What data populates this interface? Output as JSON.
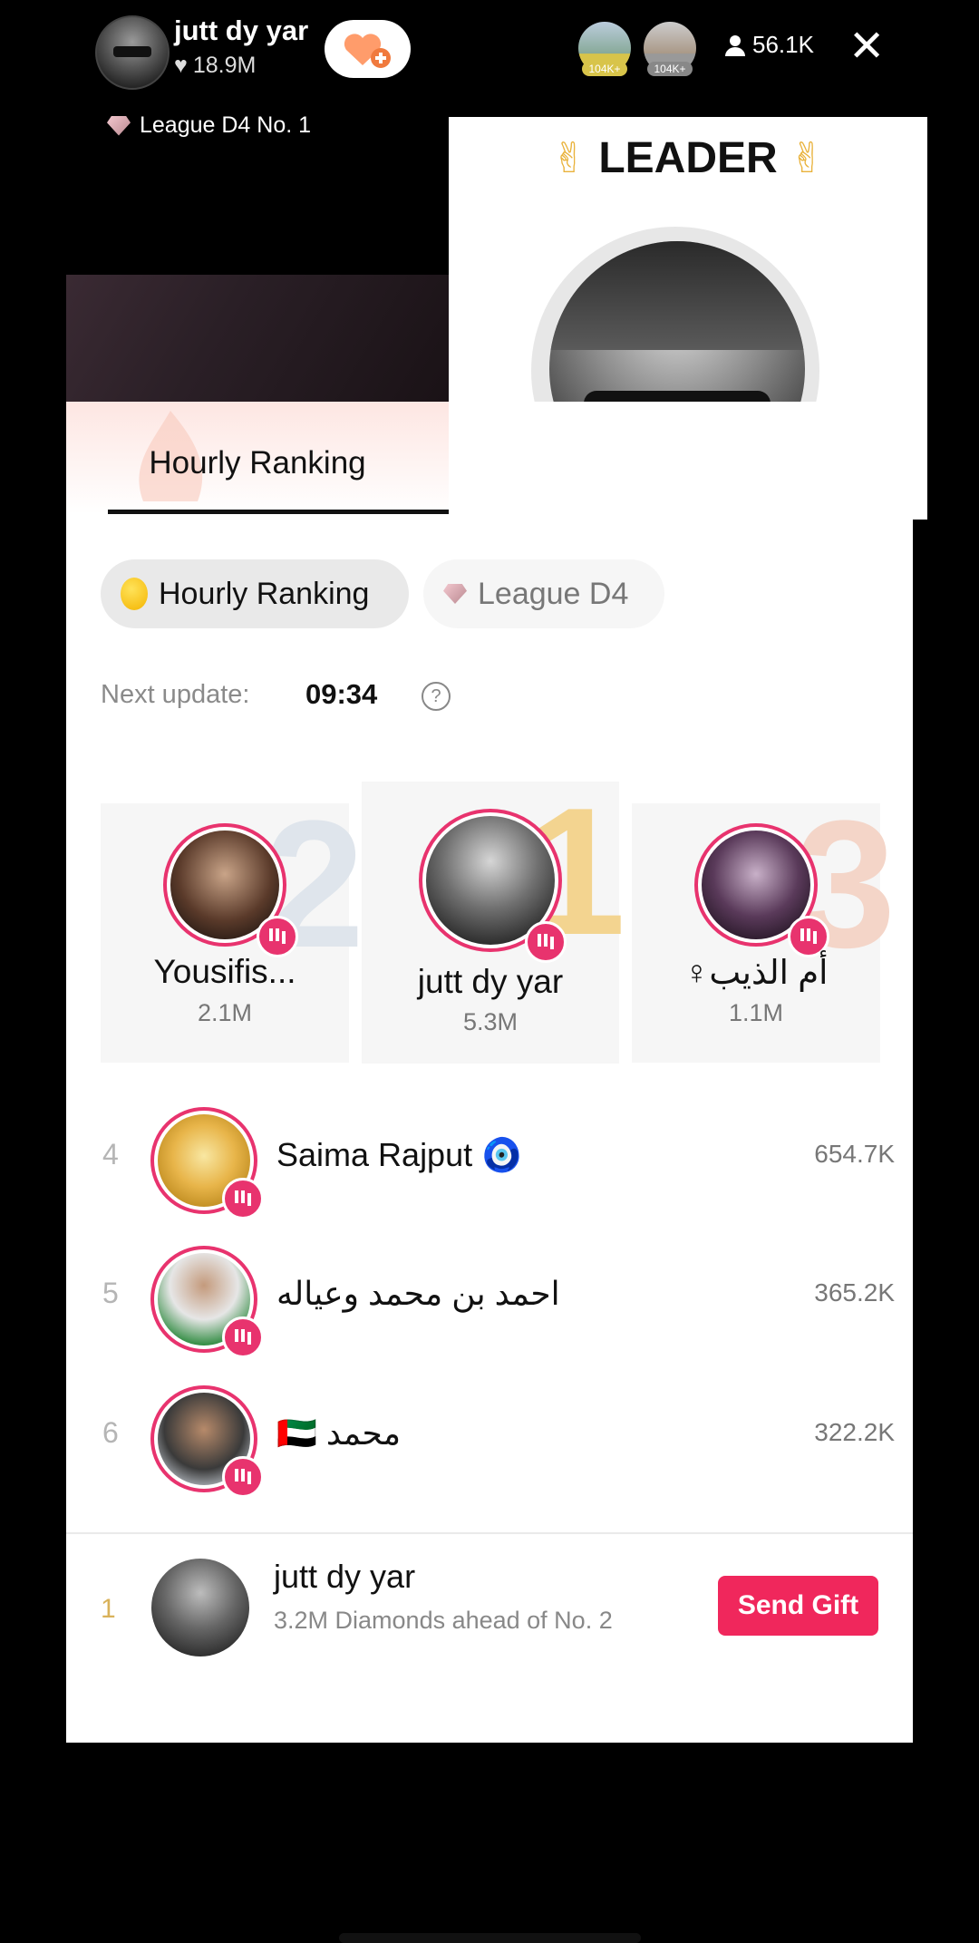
{
  "top_bar": {
    "host_name": "jutt dy yar",
    "host_likes": "18.9M",
    "viewer_badges": [
      "104K+",
      "104K+"
    ],
    "viewer_count": "56.1K",
    "close_icon": "close-icon"
  },
  "league_tag": "League D4 No. 1",
  "leader_card": {
    "title": "LEADER"
  },
  "panel": {
    "tab_label": "Hourly Ranking",
    "chips": {
      "hourly": "Hourly Ranking",
      "league": "League D4"
    },
    "next_update_label": "Next update:",
    "next_update_time": "09:34"
  },
  "podium": [
    {
      "rank": "2",
      "name": "Yousifis...",
      "score": "2.1M"
    },
    {
      "rank": "1",
      "name": "jutt dy yar",
      "score": "5.3M"
    },
    {
      "rank": "3",
      "name": "أم الذيب♀",
      "score": "1.1M"
    }
  ],
  "list": [
    {
      "rank": "4",
      "name": "Saima Rajput 🧿",
      "score": "654.7K"
    },
    {
      "rank": "5",
      "name": "احمد بن محمد وعياله",
      "score": "365.2K"
    },
    {
      "rank": "6",
      "name": "🇦🇪 محمد",
      "score": "322.2K"
    }
  ],
  "footer": {
    "rank": "1",
    "name": "jutt dy yar",
    "subtitle": "3.2M Diamonds ahead of No. 2",
    "send_label": "Send Gift"
  },
  "colors": {
    "accent": "#f0275c",
    "live_ring": "#e8336e",
    "gold": "#e9b23b"
  }
}
